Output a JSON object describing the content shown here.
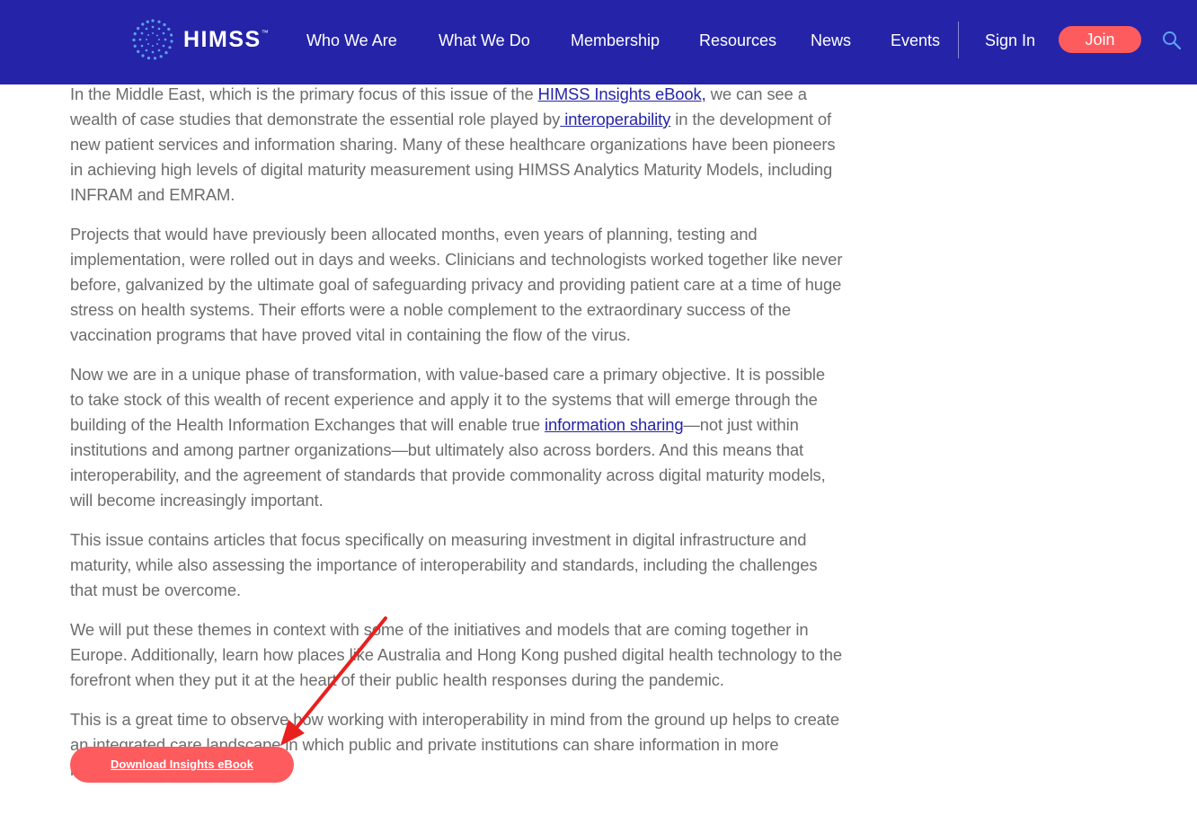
{
  "header": {
    "logo_text": "HIMSS",
    "logo_mark": "™",
    "nav": [
      "Who We Are",
      "What We Do",
      "Membership",
      "Resources",
      "News",
      "Events"
    ],
    "sign_in": "Sign In",
    "join": "Join",
    "search_icon": "search-icon"
  },
  "article": {
    "p1": {
      "t1": "In the Middle East, which is the primary focus of this issue of the ",
      "link1": "HIMSS Insights eBook,",
      "t2": " we can see a wealth of case studies that demonstrate the essential role played by",
      "link2": " interoperability",
      "t3": " in the development of new patient services and information sharing. Many of these healthcare organizations have been pioneers in achieving high levels of digital maturity measurement using HIMSS Analytics Maturity Models, including INFRAM and EMRAM."
    },
    "p2": "Projects that would have previously been allocated months, even years of planning, testing and implementation, were rolled out in days and weeks. Clinicians and technologists worked together like never before, galvanized by the ultimate goal of safeguarding privacy and providing patient care at a time of huge stress on health systems. Their efforts were a noble complement to the extraordinary success of the vaccination programs that have proved vital in containing the flow of the virus.",
    "p3": {
      "t1": "Now we are in a unique phase of transformation, with value-based care a primary objective.  It is possible to take stock of this wealth of recent experience and apply it to the systems that will emerge through the building of the Health Information Exchanges that will enable true ",
      "link": "information sharing",
      "t2": "—not just within institutions and among partner organizations—but ultimately also across borders. And this means that interoperability, and the agreement of standards that provide commonality across digital maturity models, will become increasingly important."
    },
    "p4": "This issue contains articles that focus specifically on measuring investment in digital infrastructure and maturity, while also assessing the importance of interoperability and standards, including the challenges that must be overcome.",
    "p5": "We will put these themes in context with some of the initiatives and models that are coming together in Europe. Additionally, learn how places like Australia and Hong Kong pushed digital health technology to the forefront when they put it at the heart of their public health responses during the pandemic.",
    "p6": "This is a great time to observe how working with interoperability in mind from the ground up helps to create an integrated care landscape in which public and private institutions can share information in more innovative ways.",
    "download_button": "Download Insights eBook"
  },
  "colors": {
    "nav_bg": "#2524a8",
    "accent": "#fe5b5e",
    "body_text": "#6c6c6c",
    "link": "#2524a8",
    "annotation_arrow": "#e8201e"
  }
}
